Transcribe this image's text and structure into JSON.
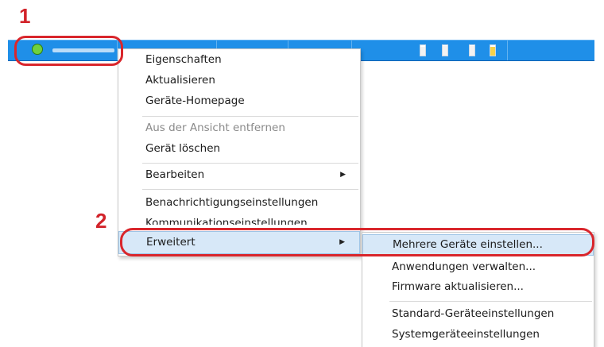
{
  "steps": {
    "one": "1",
    "two": "2"
  },
  "colors": {
    "row": "#1f8fe8",
    "callout": "#d9262c",
    "highlight": "#d7e8f8",
    "status": "#6fd13e"
  },
  "device": {
    "status_icon": "green-status-dot-icon",
    "toner_levels": [
      0.85,
      0.9,
      0.9,
      0.85
    ]
  },
  "context_menu": {
    "items": [
      {
        "label": "Eigenschaften"
      },
      {
        "label": "Aktualisieren"
      },
      {
        "label": "Geräte-Homepage"
      },
      {
        "label": "Aus der Ansicht entfernen"
      },
      {
        "label": "Gerät löschen"
      },
      {
        "label": "Bearbeiten",
        "submenu_icon": "chevron-right-icon"
      },
      {
        "label": "Benachrichtigungseinstellungen"
      },
      {
        "label": "Kommunikationseinstellungen"
      },
      {
        "label": "Erweitert",
        "submenu_icon": "chevron-right-icon"
      }
    ]
  },
  "submenu": {
    "items": [
      {
        "label": "Mehrere Geräte einstellen..."
      },
      {
        "label": "Anwendungen verwalten..."
      },
      {
        "label": "Firmware aktualisieren..."
      },
      {
        "label": "Standard-Geräteeinstellungen"
      },
      {
        "label": "Systemgeräteeinstellungen"
      }
    ]
  }
}
